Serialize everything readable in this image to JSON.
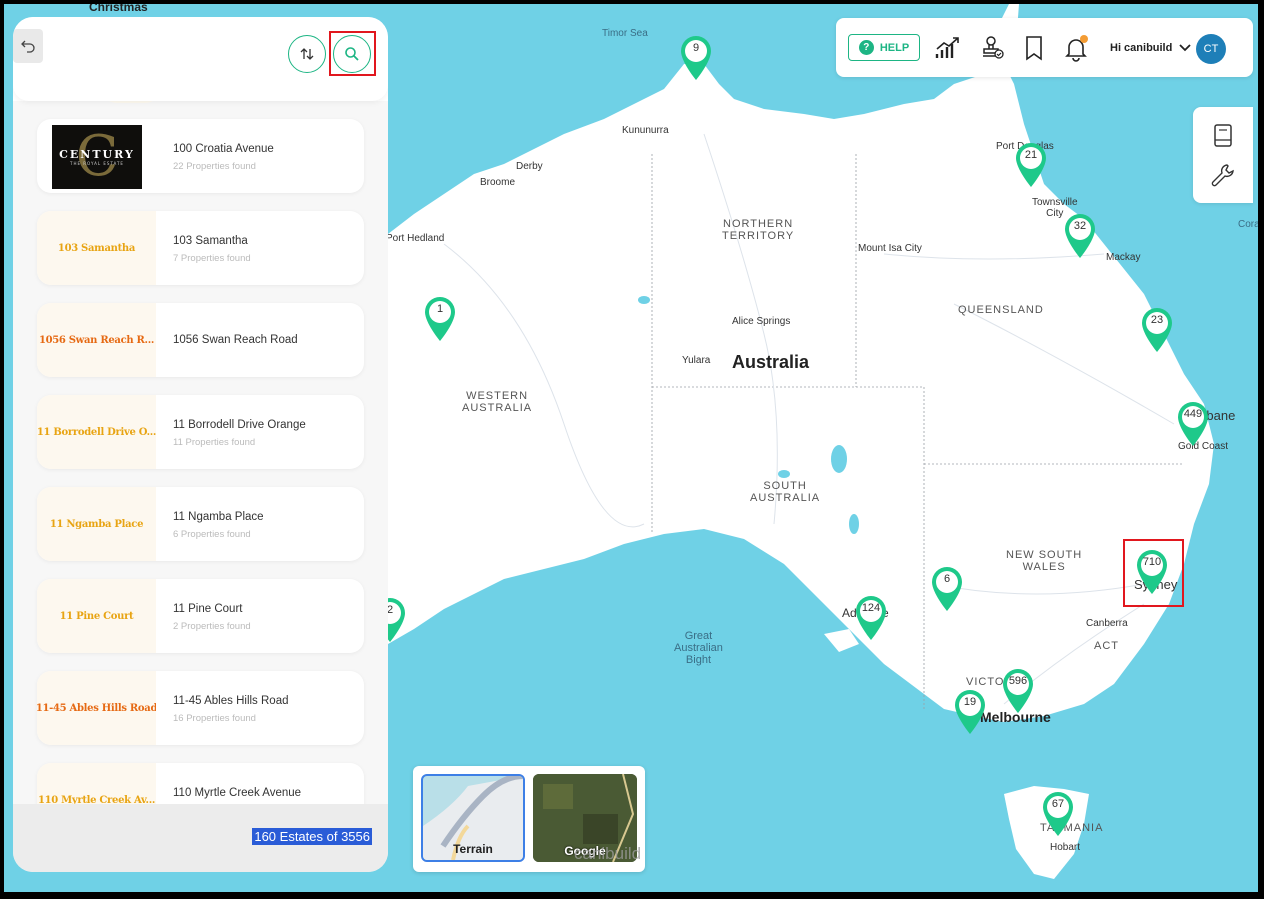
{
  "colors": {
    "accent": "#1db584",
    "ocean": "#6fd1e6",
    "highlight": "#e1171e",
    "avatar": "#1e7fb8",
    "footer_badge": "#2a5cd7"
  },
  "panel": {
    "back_icon": "undo-icon",
    "sort_icon": "sort-arrows-icon",
    "search_icon": "search-icon",
    "estates": [
      {
        "thumb_text": "CENTURY",
        "name": "100 Croatia Avenue",
        "count": "22 Properties found",
        "logo": true
      },
      {
        "thumb_text": "103 Samantha",
        "name": "103 Samantha",
        "count": "7 Properties found"
      },
      {
        "thumb_text": "1056 Swan Reach R...",
        "name": "1056 Swan Reach Road",
        "count": ""
      },
      {
        "thumb_text": "11 Borrodell Drive O...",
        "name": "11 Borrodell Drive Orange",
        "count": "11 Properties found"
      },
      {
        "thumb_text": "11 Ngamba Place",
        "name": "11 Ngamba Place",
        "count": "6 Properties found"
      },
      {
        "thumb_text": "11 Pine Court",
        "name": "11 Pine Court",
        "count": "2 Properties found"
      },
      {
        "thumb_text": "11-45 Ables Hills Road",
        "name": "11-45 Ables Hills Road",
        "count": "16 Properties found"
      },
      {
        "thumb_text": "110 Myrtle Creek Av...",
        "name": "110 Myrtle Creek Avenue",
        "count": ""
      }
    ],
    "footer_count": "160 Estates of 3556"
  },
  "topbar": {
    "help_label": "HELP",
    "greeting": "Hi canibuild",
    "avatar_initials": "CT",
    "icons": [
      "analytics-chart-icon",
      "stamp-approval-icon",
      "bookmark-icon",
      "bell-icon",
      "chevron-down-icon"
    ]
  },
  "sidetools": {
    "icons": [
      "book-icon",
      "wrench-icon"
    ]
  },
  "map": {
    "labels": {
      "christmas": "Christmas",
      "timor_sea": "Timor Sea",
      "kununurra": "Kununurra",
      "derby": "Derby",
      "broome": "Broome",
      "port_hedland": "Port Hedland",
      "northern_territory": "NORTHERN\nTERRITORY",
      "mount_isa": "Mount Isa City",
      "queensland": "QUEENSLAND",
      "alice_springs": "Alice Springs",
      "yulara": "Yulara",
      "australia": "Australia",
      "western_australia": "WESTERN\nAUSTRALIA",
      "south_australia": "SOUTH\nAUSTRALIA",
      "new_south_wales": "NEW SOUTH\nWALES",
      "townsville": "Townsville\nCity",
      "mackay": "Mackay",
      "port_douglas": "Port Douglas",
      "brisbane": "Brisbane",
      "gold_coast": "Gold Coast",
      "sydney": "Sydney",
      "canberra": "Canberra",
      "act": "ACT",
      "adelaide": "Adelaide",
      "great_australian_bight": "Great\nAustralian\nBight",
      "victoria": "VICTORIA",
      "melbourne": "Melbourne",
      "tasmania": "TASMANIA",
      "hobart": "Hobart",
      "coral": "Cora"
    },
    "clusters": [
      "9",
      "21",
      "32",
      "1",
      "23",
      "449",
      "710",
      "6",
      "124",
      "596",
      "19",
      "67",
      "2"
    ],
    "map_types": [
      "Terrain",
      "Google"
    ],
    "watermark": "canibuild"
  }
}
